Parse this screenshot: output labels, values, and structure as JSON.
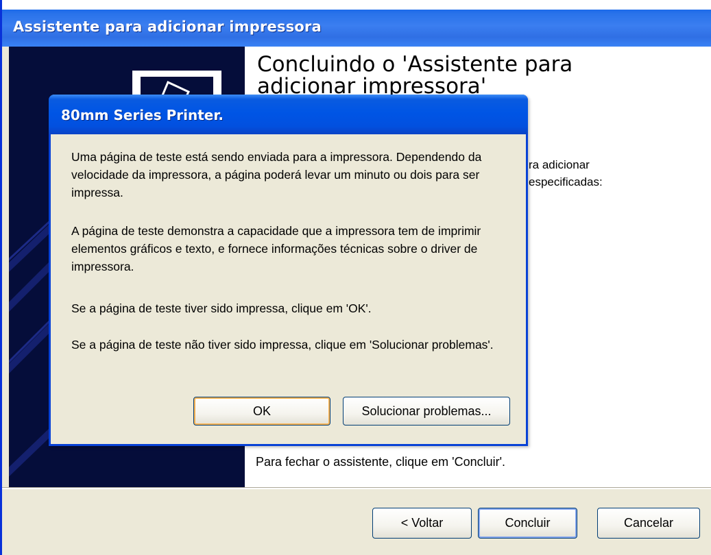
{
  "wizard": {
    "title": "Assistente para adicionar impressora",
    "heading": "Concluindo o 'Assistente para adicionar impressora'",
    "side_text_line1": "ra adicionar",
    "side_text_line2": "especificadas:",
    "close_hint": "Para fechar o assistente, clique em 'Concluir'.",
    "buttons": {
      "back": "< Voltar",
      "finish": "Concluir",
      "cancel": "Cancelar"
    }
  },
  "dialog": {
    "title": "80mm Series Printer.",
    "paragraph1": "Uma página de teste está sendo enviada para a impressora. Dependendo da velocidade da impressora, a página poderá levar um minuto ou dois para ser impressa.",
    "paragraph2": "A página de teste demonstra a capacidade que a impressora tem de imprimir elementos gráficos e texto, e fornece informações técnicas sobre o driver de impressora.",
    "paragraph3": "Se a página de teste tiver sido impressa, clique em 'OK'.",
    "paragraph4": "Se a página de teste não tiver sido impressa, clique em 'Solucionar problemas'.",
    "buttons": {
      "ok": "OK",
      "troubleshoot": "Solucionar problemas..."
    }
  },
  "colors": {
    "titlebar_blue": "#0a5be0",
    "window_face": "#ece9d8",
    "banner_navy": "#050d3a"
  },
  "icons": {
    "banner_printer": "printer-wizard-icon"
  }
}
